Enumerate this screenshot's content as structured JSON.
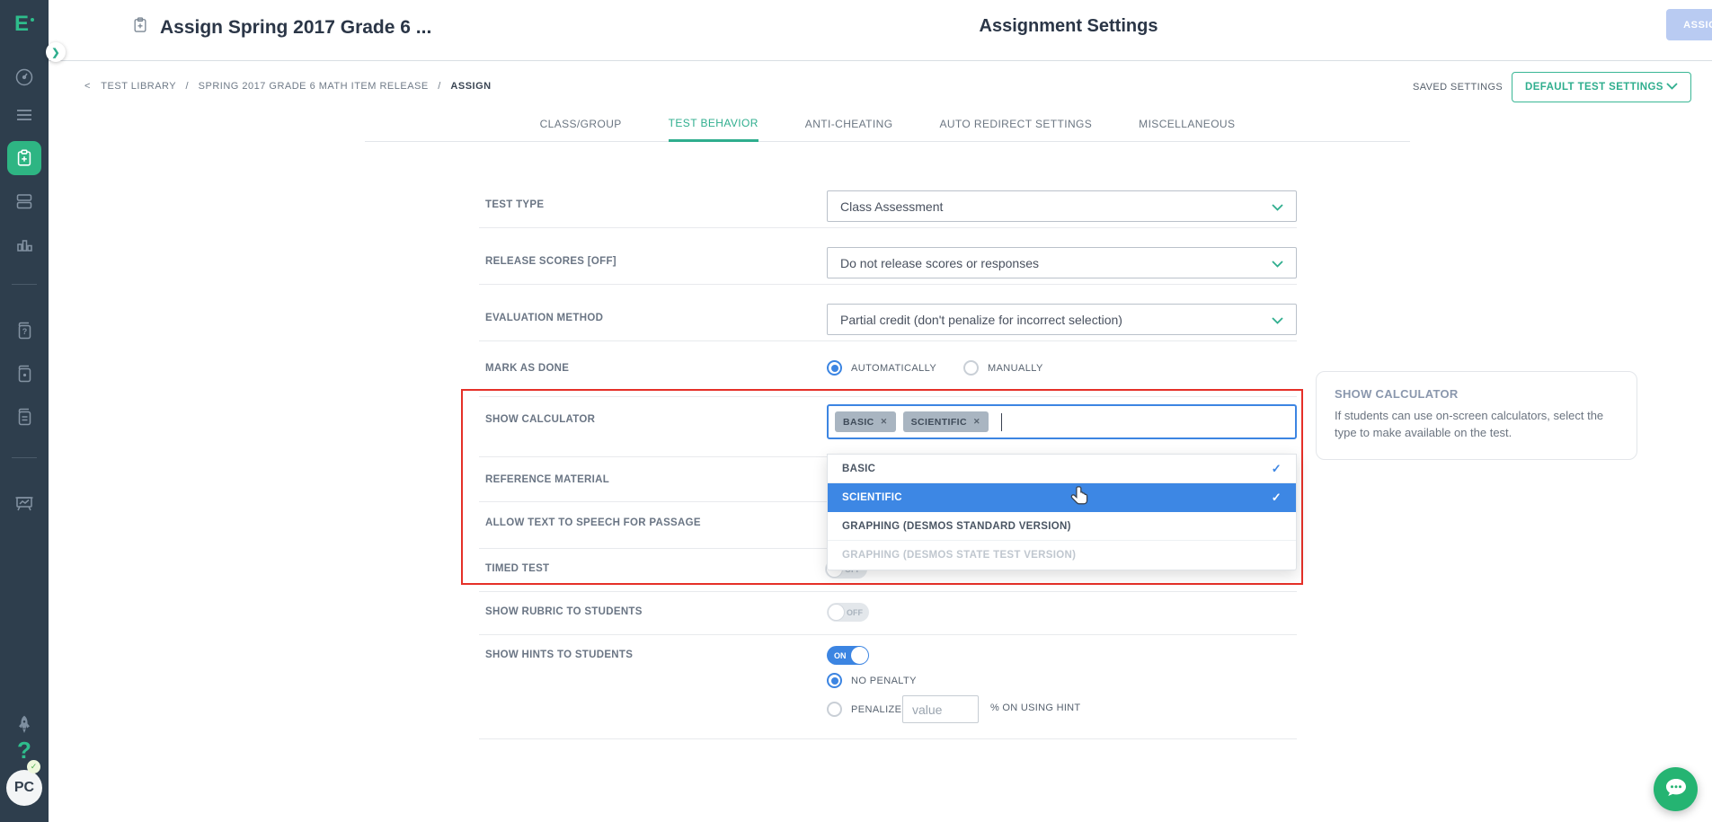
{
  "icons": {
    "check": "✓",
    "close": "✕",
    "back_chevron": "❯",
    "separator": "/"
  },
  "sidebar": {
    "logo_letter": "E",
    "help_glyph": "?",
    "avatar_initials": "PC",
    "avatar_badge_check": "✓"
  },
  "header": {
    "title": "Assign Spring 2017 Grade 6 ...",
    "center_title": "Assignment Settings",
    "assign_button": "ASSIGN"
  },
  "breadcrumb": {
    "back_arrow": "<",
    "items": [
      "TEST LIBRARY",
      "SPRING 2017 GRADE 6 MATH ITEM RELEASE",
      "ASSIGN"
    ]
  },
  "saved_settings": {
    "label": "SAVED SETTINGS",
    "dropdown_value": "DEFAULT TEST SETTINGS"
  },
  "tabs": [
    {
      "label": "CLASS/GROUP",
      "active": false
    },
    {
      "label": "TEST BEHAVIOR",
      "active": true
    },
    {
      "label": "ANTI-CHEATING",
      "active": false
    },
    {
      "label": "AUTO REDIRECT SETTINGS",
      "active": false
    },
    {
      "label": "MISCELLANEOUS",
      "active": false
    }
  ],
  "form": {
    "test_type": {
      "label": "TEST TYPE",
      "value": "Class Assessment"
    },
    "release_scores": {
      "label": "RELEASE SCORES [OFF]",
      "value": "Do not release scores or responses"
    },
    "evaluation_method": {
      "label": "EVALUATION METHOD",
      "value": "Partial credit (don't penalize for incorrect selection)"
    },
    "mark_as_done": {
      "label": "MARK AS DONE",
      "options": [
        "AUTOMATICALLY",
        "MANUALLY"
      ],
      "selected": "AUTOMATICALLY"
    },
    "show_calculator": {
      "label": "SHOW CALCULATOR",
      "tags": [
        "BASIC",
        "SCIENTIFIC"
      ]
    },
    "reference_material": {
      "label": "REFERENCE MATERIAL"
    },
    "text_to_speech": {
      "label": "ALLOW TEXT TO SPEECH FOR PASSAGE"
    },
    "timed_test": {
      "label": "TIMED TEST",
      "state": "OFF"
    },
    "show_rubric": {
      "label": "SHOW RUBRIC TO STUDENTS",
      "state": "OFF"
    },
    "show_hints": {
      "label": "SHOW HINTS TO STUDENTS",
      "state": "ON",
      "penalty": {
        "options": [
          "NO PENALTY",
          "PENALIZE"
        ],
        "selected": "NO PENALTY",
        "value_placeholder": "value",
        "suffix": "% ON USING HINT"
      }
    }
  },
  "calculator_dropdown": {
    "options": [
      {
        "label": "BASIC",
        "checked": true,
        "highlighted": false,
        "disabled": false
      },
      {
        "label": "SCIENTIFIC",
        "checked": true,
        "highlighted": true,
        "disabled": false
      },
      {
        "label": "GRAPHING (DESMOS STANDARD VERSION)",
        "checked": false,
        "highlighted": false,
        "disabled": false
      },
      {
        "label": "GRAPHING (DESMOS STATE TEST VERSION)",
        "checked": false,
        "highlighted": false,
        "disabled": true
      }
    ]
  },
  "help_card": {
    "title": "SHOW CALCULATOR",
    "body": "If students can use on-screen calculators, select the type to make available on the test."
  },
  "colors": {
    "accent_green": "#2fae8e",
    "primary_blue": "#3c85e2",
    "alert_red": "#e53028",
    "assign_button": "#b9cbf2",
    "sidebar_bg": "#2e3e4d",
    "tag_gray": "#a9b5c1"
  }
}
